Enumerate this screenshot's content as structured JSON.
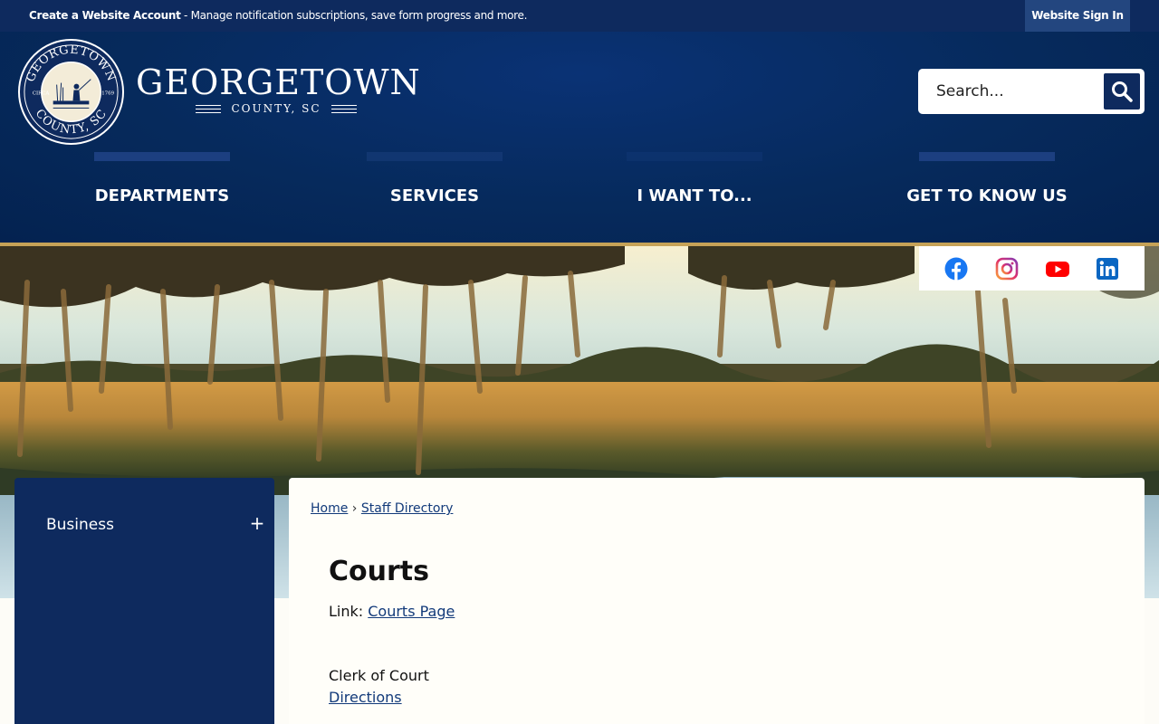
{
  "topbar": {
    "account_bold": "Create a Website Account",
    "account_rest": " - Manage notification subscriptions, save form progress and more.",
    "signin_label": "Website Sign In"
  },
  "brand": {
    "title": "GEORGETOWN",
    "subtitle": "COUNTY, SC",
    "seal_top": "GEORGETOWN",
    "seal_bottom": "COUNTY, SC",
    "seal_left": "CIRCA",
    "seal_right": "1769"
  },
  "search": {
    "placeholder": "Search...",
    "button_icon": "search-icon"
  },
  "nav": [
    {
      "label": "DEPARTMENTS"
    },
    {
      "label": "SERVICES"
    },
    {
      "label": "I WANT TO..."
    },
    {
      "label": "GET TO KNOW US"
    }
  ],
  "social": [
    {
      "name": "facebook-icon",
      "color": "#1877f2"
    },
    {
      "name": "instagram-icon",
      "color": "#c13584"
    },
    {
      "name": "youtube-icon",
      "color": "#ff0000"
    },
    {
      "name": "linkedin-icon",
      "color": "#0a66c2"
    }
  ],
  "sidebar": {
    "items": [
      {
        "label": "Business",
        "toggle": "+"
      }
    ]
  },
  "breadcrumb": {
    "home": "Home",
    "sep": "›",
    "current": "Staff Directory"
  },
  "page": {
    "title": "Courts",
    "link_prefix": "Link: ",
    "link_label": "Courts Page",
    "office_name": "Clerk of Court",
    "directions_label": "Directions"
  },
  "colors": {
    "primary": "#0e2a5e",
    "accent_gold": "#c6a257",
    "link": "#123a7a"
  }
}
